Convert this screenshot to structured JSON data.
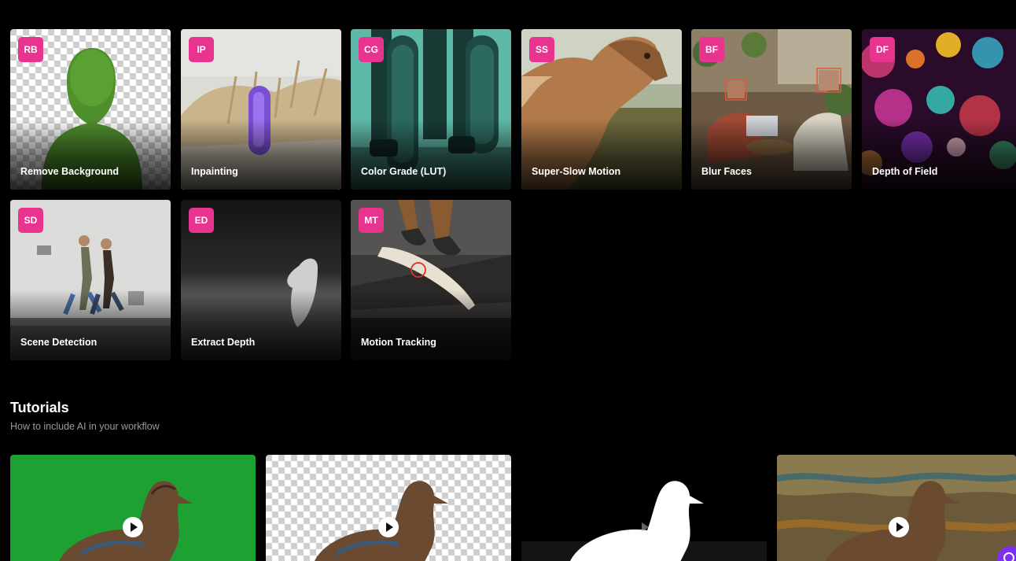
{
  "tools": [
    {
      "id": "rb",
      "badge": "RB",
      "label": "Remove Background"
    },
    {
      "id": "ip",
      "badge": "IP",
      "label": "Inpainting"
    },
    {
      "id": "cg",
      "badge": "CG",
      "label": "Color Grade (LUT)"
    },
    {
      "id": "ss",
      "badge": "SS",
      "label": "Super-Slow Motion"
    },
    {
      "id": "bf",
      "badge": "BF",
      "label": "Blur Faces"
    },
    {
      "id": "df",
      "badge": "DF",
      "label": "Depth of Field"
    },
    {
      "id": "sd",
      "badge": "SD",
      "label": "Scene Detection"
    },
    {
      "id": "ed",
      "badge": "ED",
      "label": "Extract Depth"
    },
    {
      "id": "mt",
      "badge": "MT",
      "label": "Motion Tracking"
    }
  ],
  "tutorials": {
    "title": "Tutorials",
    "subtitle": "How to include AI in your workflow"
  },
  "colors": {
    "background": "#000000",
    "badge": "#e8338f",
    "subtitle": "#9a9aa6",
    "chat": "#7b2ff7"
  }
}
